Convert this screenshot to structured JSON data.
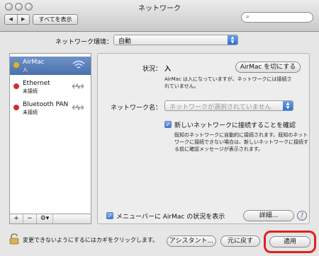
{
  "window": {
    "title": "ネットワーク"
  },
  "toolbar": {
    "back": "◀",
    "forward": "▶",
    "show_all": "すべてを表示",
    "search_placeholder": ""
  },
  "location": {
    "label": "ネットワーク環境：",
    "value": "自動"
  },
  "services": [
    {
      "name": "AirMac",
      "status": "入",
      "dot_color": "#e8b21c",
      "icon": "wifi-icon",
      "selected": true
    },
    {
      "name": "Ethernet",
      "status": "未接続",
      "dot_color": "#d72b2b",
      "icon": "ethernet-arrows-icon",
      "selected": false
    },
    {
      "name": "Bluetooth PAN",
      "status": "未接続",
      "dot_color": "#d72b2b",
      "icon": "bluetooth-arrows-icon",
      "selected": false
    }
  ],
  "sidebar_footer": {
    "add": "+",
    "remove": "−",
    "action": "⚙▾"
  },
  "detail": {
    "status_label": "状況：",
    "status_value": "入",
    "airmac_off_button": "AirMac を切にする",
    "status_desc_line1": "AirMac は入になっていますが、ネットワークには接続さ",
    "status_desc_line2": "れていません。",
    "network_name_label": "ネットワーク名：",
    "network_name_value": "ネットワークが選択されていません",
    "ask_join_label": "新しいネットワークに接続することを確認",
    "ask_join_desc_line1": "既知のネットワークに自動的に接続されます。既知のネット",
    "ask_join_desc_line2": "ワークに接続できない場合は、新しいネットワークに接続す",
    "ask_join_desc_line3": "る前に確認メッセージが表示されます。",
    "menubar_label": "メニューバーに AirMac の状況を表示",
    "advanced_button": "詳細...",
    "help": "?"
  },
  "footer": {
    "lock_text": "変更できないようにするにはカギをクリックします。",
    "assistant_button": "アシスタント...",
    "revert_button": "元に戻す",
    "apply_button": "適用"
  }
}
